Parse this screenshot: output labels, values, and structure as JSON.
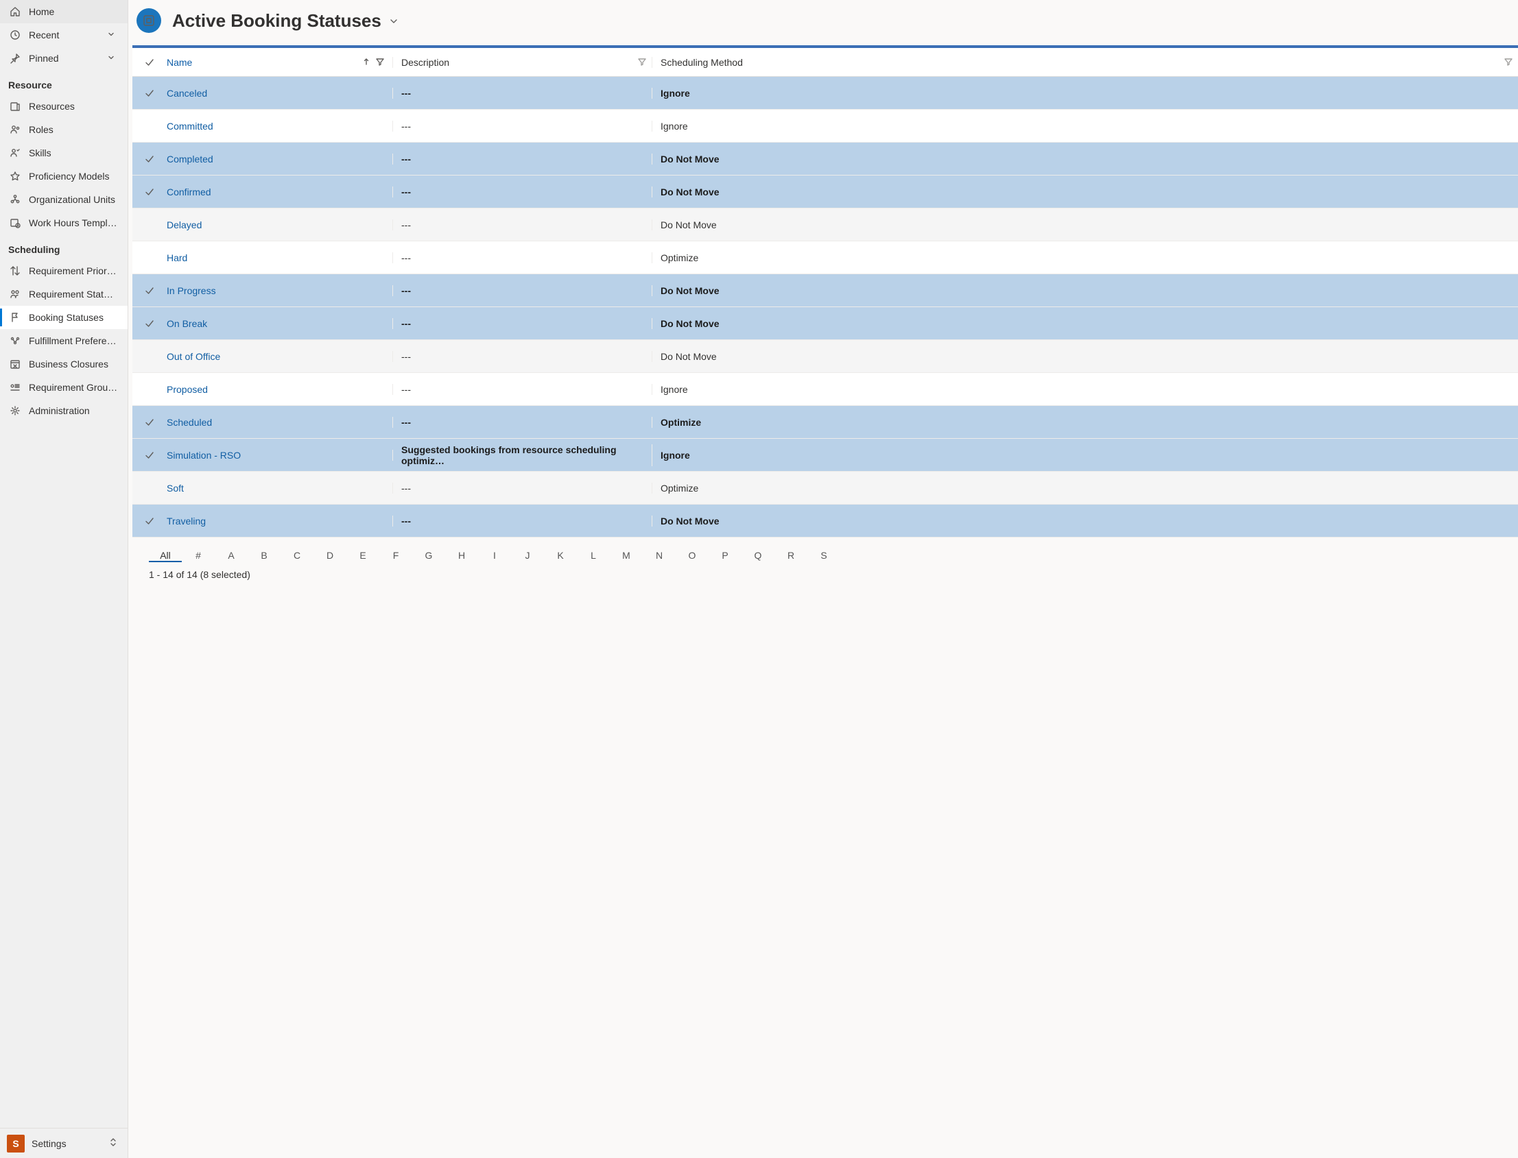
{
  "sidebar": {
    "top": [
      {
        "label": "Home",
        "icon": "home-icon"
      },
      {
        "label": "Recent",
        "icon": "clock-icon",
        "expando": true
      },
      {
        "label": "Pinned",
        "icon": "pin-icon",
        "expando": true
      }
    ],
    "sections": [
      {
        "title": "Resource",
        "items": [
          {
            "label": "Resources",
            "icon": "resources-icon"
          },
          {
            "label": "Roles",
            "icon": "roles-icon"
          },
          {
            "label": "Skills",
            "icon": "skills-icon"
          },
          {
            "label": "Proficiency Models",
            "icon": "star-icon"
          },
          {
            "label": "Organizational Units",
            "icon": "org-icon"
          },
          {
            "label": "Work Hours Templates",
            "icon": "workhours-icon"
          }
        ]
      },
      {
        "title": "Scheduling",
        "items": [
          {
            "label": "Requirement Priorities",
            "icon": "priority-icon"
          },
          {
            "label": "Requirement Statuses",
            "icon": "reqstatus-icon"
          },
          {
            "label": "Booking Statuses",
            "icon": "flag-icon",
            "active": true
          },
          {
            "label": "Fulfillment Preferences",
            "icon": "fulfill-icon"
          },
          {
            "label": "Business Closures",
            "icon": "closure-icon"
          },
          {
            "label": "Requirement Group …",
            "icon": "reqgroup-icon"
          },
          {
            "label": "Administration",
            "icon": "gear-icon"
          }
        ]
      }
    ],
    "area": {
      "badge": "S",
      "label": "Settings"
    }
  },
  "header": {
    "title": "Active Booking Statuses"
  },
  "grid": {
    "columns": {
      "name": "Name",
      "description": "Description",
      "method": "Scheduling Method"
    },
    "rows": [
      {
        "selected": true,
        "name": "Canceled",
        "description": "---",
        "method": "Ignore"
      },
      {
        "selected": false,
        "name": "Committed",
        "description": "---",
        "method": "Ignore"
      },
      {
        "selected": true,
        "name": "Completed",
        "description": "---",
        "method": "Do Not Move"
      },
      {
        "selected": true,
        "name": "Confirmed",
        "description": "---",
        "method": "Do Not Move"
      },
      {
        "selected": false,
        "alt": true,
        "name": "Delayed",
        "description": "---",
        "method": "Do Not Move"
      },
      {
        "selected": false,
        "name": "Hard",
        "description": "---",
        "method": "Optimize"
      },
      {
        "selected": true,
        "name": "In Progress",
        "description": "---",
        "method": "Do Not Move"
      },
      {
        "selected": true,
        "name": "On Break",
        "description": "---",
        "method": "Do Not Move"
      },
      {
        "selected": false,
        "alt": true,
        "name": "Out of Office",
        "description": "---",
        "method": "Do Not Move"
      },
      {
        "selected": false,
        "name": "Proposed",
        "description": "---",
        "method": "Ignore"
      },
      {
        "selected": true,
        "name": "Scheduled",
        "description": "---",
        "method": "Optimize"
      },
      {
        "selected": true,
        "name": "Simulation - RSO",
        "description": "Suggested bookings from resource scheduling optimiz…",
        "method": "Ignore"
      },
      {
        "selected": false,
        "alt": true,
        "name": "Soft",
        "description": "---",
        "method": "Optimize"
      },
      {
        "selected": true,
        "name": "Traveling",
        "description": "---",
        "method": "Do Not Move"
      }
    ],
    "alpha": [
      "All",
      "#",
      "A",
      "B",
      "C",
      "D",
      "E",
      "F",
      "G",
      "H",
      "I",
      "J",
      "K",
      "L",
      "M",
      "N",
      "O",
      "P",
      "Q",
      "R",
      "S"
    ],
    "footer": "1 - 14 of 14 (8 selected)"
  }
}
